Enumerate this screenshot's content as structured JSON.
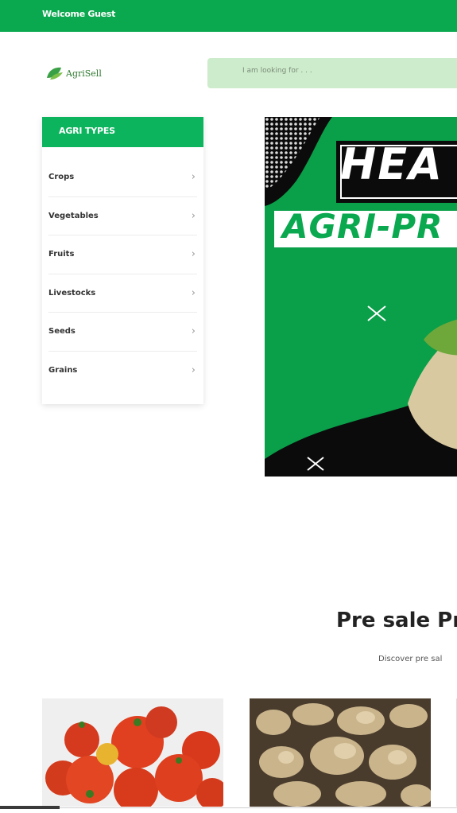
{
  "topbar": {
    "welcome": "Welcome Guest"
  },
  "header": {
    "logo_text": "AgriSell",
    "search_placeholder": "I am looking for . . ."
  },
  "sidebar": {
    "title": "AGRI TYPES",
    "items": [
      {
        "label": "Crops"
      },
      {
        "label": "Vegetables"
      },
      {
        "label": "Fruits"
      },
      {
        "label": "Livestocks"
      },
      {
        "label": "Seeds"
      },
      {
        "label": "Grains"
      }
    ]
  },
  "banner": {
    "heading": "HEA",
    "subheading": "AGRI-PR"
  },
  "presale": {
    "title": "Pre sale Pr",
    "subtitle": "Discover pre sal"
  },
  "products": [
    {
      "name": "tomatoes"
    },
    {
      "name": "ginger"
    }
  ],
  "colors": {
    "brand_green": "#0aa84f",
    "search_bg": "#cdeccb"
  },
  "icons": [
    "leaf-logo-icon",
    "chevron-right-icon",
    "search-icon"
  ]
}
